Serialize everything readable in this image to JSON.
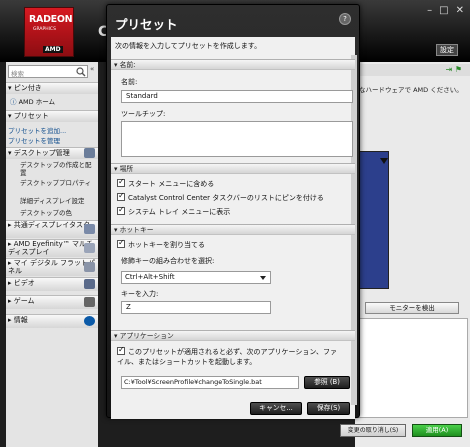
{
  "main": {
    "logo": {
      "line1": "RADEON",
      "line2": "GRAPHICS",
      "line3": "AMD"
    },
    "title_cut": "C",
    "window_buttons": [
      "–",
      "□",
      "✕"
    ],
    "settings_label": "設定",
    "search_placeholder": "検索",
    "sidebar": {
      "pinned": "ピン付き",
      "amd_home": "AMD ホーム",
      "presets": "プリセット",
      "add_preset": "プリセットを追加...",
      "manage_presets": "プリセットを管理",
      "desktop_management": "デスクトップ管理",
      "desktop_create": "デスクトップの作成と配置",
      "desktop_properties": "デスクトッププロパティ",
      "detail_display": "詳細ディスプレイ設定",
      "desktop_color": "デスクトップの色",
      "shared_display": "共通ディスプレイタスク",
      "eyefinity": "AMD Eyefinity™ マルチディスプレイ",
      "digital_flat": "マイ デジタル フラットパネル",
      "video": "ビデオ",
      "gaming": "ゲーム",
      "info": "情報"
    },
    "right_pane": {
      "description": "なハードウェアで AMD ください。",
      "detect_button": "モニターを検出"
    },
    "undo_button": "変更の取り消し(S)",
    "apply_button": "適用(A)"
  },
  "dialog": {
    "title": "プリセット",
    "help": "?",
    "description": "次の情報を入力してプリセットを作成します。",
    "name_section": "名前:",
    "name_label": "名前:",
    "name_value": "Standard",
    "tooltip_label": "ツールチップ:",
    "location_section": "場所",
    "start_menu": "スタート メニューに含める",
    "taskbar_pin": "Catalyst Control Center タスクバーのリストにピンを付ける",
    "system_tray": "システム トレイ メニューに表示",
    "hotkey_section": "ホットキー",
    "assign_hotkey": "ホットキーを割り当てる",
    "modifier_label": "修飾キーの組み合わせを選択:",
    "modifier_value": "Ctrl+Alt+Shift",
    "key_label": "キーを入力:",
    "key_value": "Z",
    "application_section": "アプリケーション",
    "app_description": "このプリセットが適用されると必ず、次のアプリケーション、ファイル、またはショートカットを起動します。",
    "app_path": "C:¥Tool¥ScreenProfile¥changeToSingle.bat",
    "browse_button": "参照 (B)",
    "cancel_button": "キャンセ...",
    "save_button": "保存(S)"
  }
}
